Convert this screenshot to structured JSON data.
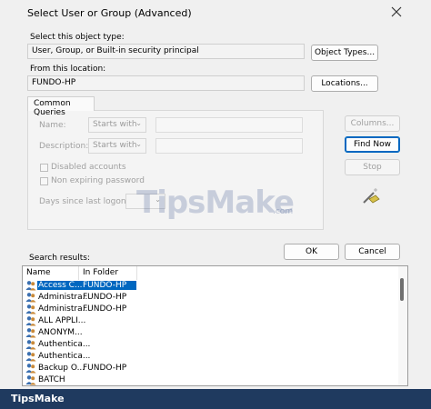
{
  "window": {
    "title": "Select User or Group (Advanced)"
  },
  "object_type": {
    "label": "Select this object type:",
    "value": "User, Group, or Built-in security principal",
    "button": "Object Types..."
  },
  "location": {
    "label": "From this location:",
    "value": "FUNDO-HP",
    "button": "Locations..."
  },
  "common_queries": {
    "tab_label": "Common Queries",
    "name_label": "Name:",
    "name_mode": "Starts with",
    "description_label": "Description:",
    "description_mode": "Starts with",
    "disabled_accounts": "Disabled accounts",
    "non_expiring_password": "Non expiring password",
    "days_since_logon": "Days since last logon:"
  },
  "side_buttons": {
    "columns": "Columns...",
    "find_now": "Find Now",
    "stop": "Stop"
  },
  "dialog_buttons": {
    "ok": "OK",
    "cancel": "Cancel"
  },
  "results": {
    "label": "Search results:",
    "columns": [
      "Name",
      "In Folder"
    ],
    "rows": [
      {
        "name": "Access C...",
        "folder": "FUNDO-HP",
        "selected": true
      },
      {
        "name": "Administra...",
        "folder": "FUNDO-HP"
      },
      {
        "name": "Administra...",
        "folder": "FUNDO-HP"
      },
      {
        "name": "ALL APPLI...",
        "folder": ""
      },
      {
        "name": "ANONYM...",
        "folder": ""
      },
      {
        "name": "Authentica...",
        "folder": ""
      },
      {
        "name": "Authentica...",
        "folder": ""
      },
      {
        "name": "Backup O...",
        "folder": "FUNDO-HP"
      },
      {
        "name": "BATCH",
        "folder": ""
      }
    ]
  },
  "watermark": {
    "text": "TipsMake",
    "suffix": ".com"
  },
  "footer": {
    "brand": "TipsMake"
  },
  "colors": {
    "selection": "#0067c0",
    "footer": "#1f3a5f"
  }
}
